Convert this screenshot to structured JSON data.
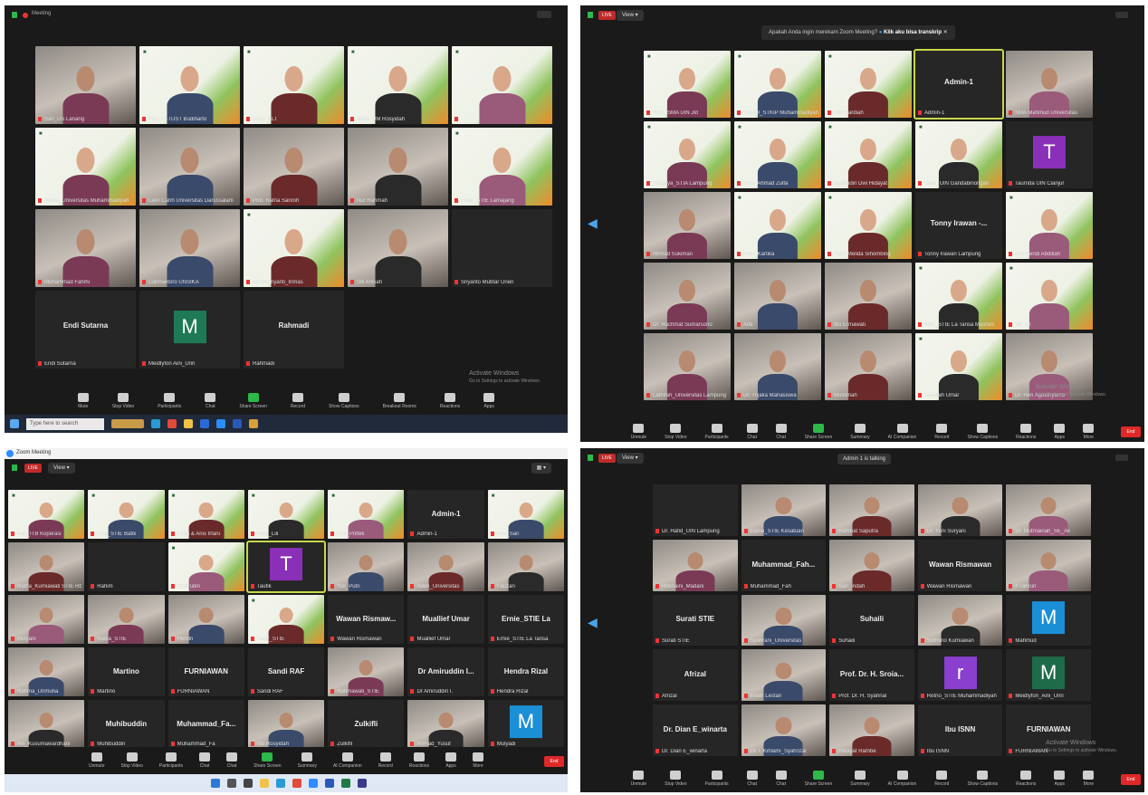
{
  "q1": {
    "title": "Meeting",
    "tiles": [
      {
        "name": "Sari_DS Lanang",
        "kind": "photo"
      },
      {
        "name": "Prin_FI-TUST Budiharto",
        "kind": "poster"
      },
      {
        "name": "Desy_SLT",
        "kind": "poster"
      },
      {
        "name": "Nelia_UM Rosyidah",
        "kind": "poster"
      },
      {
        "name": "",
        "kind": "poster"
      },
      {
        "name": "Ratna_Universitas Muhammadiyah",
        "kind": "poster"
      },
      {
        "name": "Lieni Cahh Universitas Darussalam",
        "kind": "photo"
      },
      {
        "name": "Prof. Ratna Sariroh",
        "kind": "photo"
      },
      {
        "name": "Nur Rahmah",
        "kind": "photo"
      },
      {
        "name": "Ernie_STIE Lamajang",
        "kind": "poster"
      },
      {
        "name": "Muhammad Fahmi",
        "kind": "photo"
      },
      {
        "name": "Lukmantoro UNSIKA",
        "kind": "photo"
      },
      {
        "name": "Eni Gufriyanti_Inmas",
        "kind": "poster"
      },
      {
        "name": "Siti Anisah",
        "kind": "photo"
      },
      {
        "name": "Sriyanto Mubtar Unen",
        "kind": "dark"
      },
      {
        "name": "Endi Sutarna",
        "kind": "name",
        "big": "Endi Sutarna"
      },
      {
        "name": "Meidlyfon Aini_Unri",
        "kind": "avatar",
        "letter": "M",
        "color": "#1e7a55"
      },
      {
        "name": "Rahmadi",
        "kind": "name",
        "big": "Rahmadi"
      }
    ],
    "toolbar": [
      "Mute",
      "Stop Video",
      "Participants",
      "Chat",
      "Share Screen",
      "Record",
      "Show Captions",
      "Breakout Rooms",
      "Reactions",
      "Apps"
    ],
    "taskbar_search": "Type here to search",
    "watermark": [
      "Activate Windows",
      "Go to Settings to activate Windows."
    ]
  },
  "q2": {
    "notice": "Apakah Anda ingin merekam Zoom Meeting?",
    "notice_action": "Klik aku bisa transkrip",
    "tiles": [
      {
        "name": "Ratu_SMA UIN Jkt",
        "kind": "poster"
      },
      {
        "name": "Syaiful_STKIP Muhammadiyah",
        "kind": "poster"
      },
      {
        "name": "Lilis Kardiah",
        "kind": "poster"
      },
      {
        "name": "Admin-1",
        "kind": "name",
        "big": "Admin-1",
        "active": true
      },
      {
        "name": "SMA Mahmud Universitas",
        "kind": "photo"
      },
      {
        "name": "Surgeya_STIA Lampung",
        "kind": "poster"
      },
      {
        "name": "Irma_Ahmad Zulfa",
        "kind": "poster"
      },
      {
        "name": "Syafrudin Dwi Hidayat",
        "kind": "poster"
      },
      {
        "name": "Dewi_UIN Gandabinongan",
        "kind": "poster"
      },
      {
        "name": "Taurrida UIN Cianjur",
        "kind": "avatar",
        "letter": "T",
        "color": "#8a2fb8"
      },
      {
        "name": "Ahmad Sukiman",
        "kind": "photo"
      },
      {
        "name": "Putri_Kartika",
        "kind": "poster"
      },
      {
        "name": "Yanti Melida Sihombing",
        "kind": "poster"
      },
      {
        "name": "Tonny Irawan Lampung",
        "kind": "name",
        "big": "Tonny Irawan -..."
      },
      {
        "name": "Aldi Hendi Abdillah",
        "kind": "poster"
      },
      {
        "name": "Dr. Rachmat Sumarsono",
        "kind": "photo"
      },
      {
        "name": "Alfa",
        "kind": "photo"
      },
      {
        "name": "Ibu Ermawati",
        "kind": "photo"
      },
      {
        "name": "Indri_STIE La Tansa Mashiro",
        "kind": "poster"
      },
      {
        "name": "Sri_UT",
        "kind": "poster"
      },
      {
        "name": "Lathifah_Universitas Lampung",
        "kind": "photo"
      },
      {
        "name": "Dr. Trijaka Mahasiswa",
        "kind": "photo"
      },
      {
        "name": "Muslimah",
        "kind": "photo"
      },
      {
        "name": "Saadiah Umar",
        "kind": "poster"
      },
      {
        "name": "Dr. Heri Agustriyanto",
        "kind": "photo"
      }
    ],
    "toolbar": [
      "Unmute",
      "Stop Video",
      "Participants",
      "Chat",
      "Chat",
      "Share Screen",
      "Summary",
      "AI Companion",
      "Record",
      "Show Captions",
      "Reactions",
      "Apps",
      "More"
    ],
    "watermark": [
      "Activate Windows",
      "Go to Settings to activate Windows."
    ]
  },
  "q3": {
    "title": "Zoom Meeting",
    "tiles": [
      {
        "name": "Aan_ITB Koperasi",
        "kind": "poster"
      },
      {
        "name": "Lina_STIE Batik",
        "kind": "poster"
      },
      {
        "name": "Febri & Anis Irfani",
        "kind": "poster"
      },
      {
        "name": "Ratu_Lili",
        "kind": "poster"
      },
      {
        "name": "Eva_Poltek",
        "kind": "poster"
      },
      {
        "name": "Admin-1",
        "kind": "name",
        "big": "Admin-1"
      },
      {
        "name": "Rita_Sari",
        "kind": "poster"
      },
      {
        "name": "Ratna_Kurniawati STIE Rbg",
        "kind": "photo"
      },
      {
        "name": "Rahim",
        "kind": "dark"
      },
      {
        "name": "Syafrudin",
        "kind": "poster"
      },
      {
        "name": "Taufik",
        "kind": "avatar",
        "letter": "T",
        "color": "#8a2fb8",
        "active": true
      },
      {
        "name": "Yuli_Putri",
        "kind": "photo"
      },
      {
        "name": "Aden_Universitas",
        "kind": "photo"
      },
      {
        "name": "Fauzan",
        "kind": "photo"
      },
      {
        "name": "Mulyani",
        "kind": "photo"
      },
      {
        "name": "Nadia_STIE",
        "kind": "photo"
      },
      {
        "name": "Hendri",
        "kind": "photo"
      },
      {
        "name": "Fajar_STIE",
        "kind": "poster"
      },
      {
        "name": "Wawan Rismawan",
        "kind": "name",
        "big": "Wawan Rismaw..."
      },
      {
        "name": "Muallief Umar",
        "kind": "name",
        "big": "Muallief Umar"
      },
      {
        "name": "Ernie_STIE La Tansa",
        "kind": "name",
        "big": "Ernie_STIE La"
      },
      {
        "name": "Rahma_Unmuha",
        "kind": "photo"
      },
      {
        "name": "Martino",
        "kind": "name",
        "big": "Martino"
      },
      {
        "name": "FURNIAWAN",
        "kind": "name",
        "big": "FURNIAWAN"
      },
      {
        "name": "Sandi RAF",
        "kind": "name",
        "big": "Sandi RAF"
      },
      {
        "name": "Rahmawati_STIE",
        "kind": "photo"
      },
      {
        "name": "Dr Amiruddin I.",
        "kind": "name",
        "big": "Dr Amiruddin I..."
      },
      {
        "name": "Hendra Rizal",
        "kind": "name",
        "big": "Hendra Rizal"
      },
      {
        "name": "Ani_Kusumawardhani",
        "kind": "photo"
      },
      {
        "name": "Muhibuddin",
        "kind": "name",
        "big": "Muhibuddin"
      },
      {
        "name": "Muhammad_Fa",
        "kind": "name",
        "big": "Muhammad_Fa..."
      },
      {
        "name": "Ida Rosyidah",
        "kind": "photo"
      },
      {
        "name": "Zulkifli",
        "kind": "name",
        "big": "Zulkifli"
      },
      {
        "name": "Ahmad_Yusuf",
        "kind": "photo"
      },
      {
        "name": "Mulyadi",
        "kind": "avatar",
        "letter": "M",
        "color": "#1b8fd6"
      }
    ],
    "toolbar": [
      "Unmute",
      "Stop Video",
      "Participants",
      "Chat",
      "Chat",
      "Share Screen",
      "Summary",
      "AI Companion",
      "Record",
      "Reactions",
      "Apps",
      "More"
    ],
    "taskbar_search": ""
  },
  "q4": {
    "notice": "Admin 1 is talking",
    "tiles": [
      {
        "name": "Dr. Hafid_UIN Lampung",
        "kind": "dark"
      },
      {
        "name": "Diana_STIE Kesatuan",
        "kind": "photo"
      },
      {
        "name": "Rahmat Saputra",
        "kind": "photo"
      },
      {
        "name": "Dr. Yuni Suryani",
        "kind": "photo"
      },
      {
        "name": "Dr. Mutmainah_SE_Ak",
        "kind": "photo"
      },
      {
        "name": "Rosnaini_Madani",
        "kind": "photo"
      },
      {
        "name": "Muhammad_Fah",
        "kind": "name",
        "big": "Muhammad_Fah..."
      },
      {
        "name": "Sari_Indah",
        "kind": "photo"
      },
      {
        "name": "Wawan Rismawan",
        "kind": "name",
        "big": "Wawan Rismawan"
      },
      {
        "name": "F.Tahrun",
        "kind": "photo"
      },
      {
        "name": "Surati STIE",
        "kind": "name",
        "big": "Surati STIE"
      },
      {
        "name": "Syahrani_Universitas",
        "kind": "photo"
      },
      {
        "name": "Suhaili",
        "kind": "name",
        "big": "Suhaili"
      },
      {
        "name": "Sutrisno Kurniawan",
        "kind": "photo"
      },
      {
        "name": "Mahmud",
        "kind": "avatar",
        "letter": "M",
        "color": "#1b8fd6"
      },
      {
        "name": "Afrizal",
        "kind": "name",
        "big": "Afrizal"
      },
      {
        "name": "Indah Lestari",
        "kind": "photo"
      },
      {
        "name": "Prof. Dr. H. Syahrial",
        "kind": "name",
        "big": "Prof. Dr. H. Sroia..."
      },
      {
        "name": "Retno_STIE Muhammadiyah",
        "kind": "avatar",
        "letter": "r",
        "color": "#8a3fcf"
      },
      {
        "name": "Meidlyfon_Aini_Unri",
        "kind": "avatar",
        "letter": "M",
        "color": "#1e6b4a"
      },
      {
        "name": "Dr. Dian E_winarta",
        "kind": "name",
        "big": "Dr. Dian E_winarta"
      },
      {
        "name": "Dr. I. Kihlami_Syahrizal",
        "kind": "photo"
      },
      {
        "name": "Hidayat Rambe",
        "kind": "photo"
      },
      {
        "name": "Ibu ISNN",
        "kind": "name",
        "big": "Ibu ISNN"
      },
      {
        "name": "FURNIAWAN",
        "kind": "name",
        "big": "FURNIAWAN"
      }
    ],
    "toolbar": [
      "Unmute",
      "Stop Video",
      "Participants",
      "Chat",
      "Chat",
      "Share Screen",
      "Summary",
      "AI Companion",
      "Record",
      "Show Captions",
      "Reactions",
      "Apps",
      "More"
    ],
    "watermark": [
      "Activate Windows",
      "Go to Settings to activate Windows."
    ]
  },
  "colors": {
    "zoom_bg": "#1a1a1a",
    "tile_bg": "#262626",
    "share_green": "#2db84a",
    "leave_red": "#e02828",
    "active_border": "#c8d84a",
    "nav_blue": "#4aa3e8"
  }
}
